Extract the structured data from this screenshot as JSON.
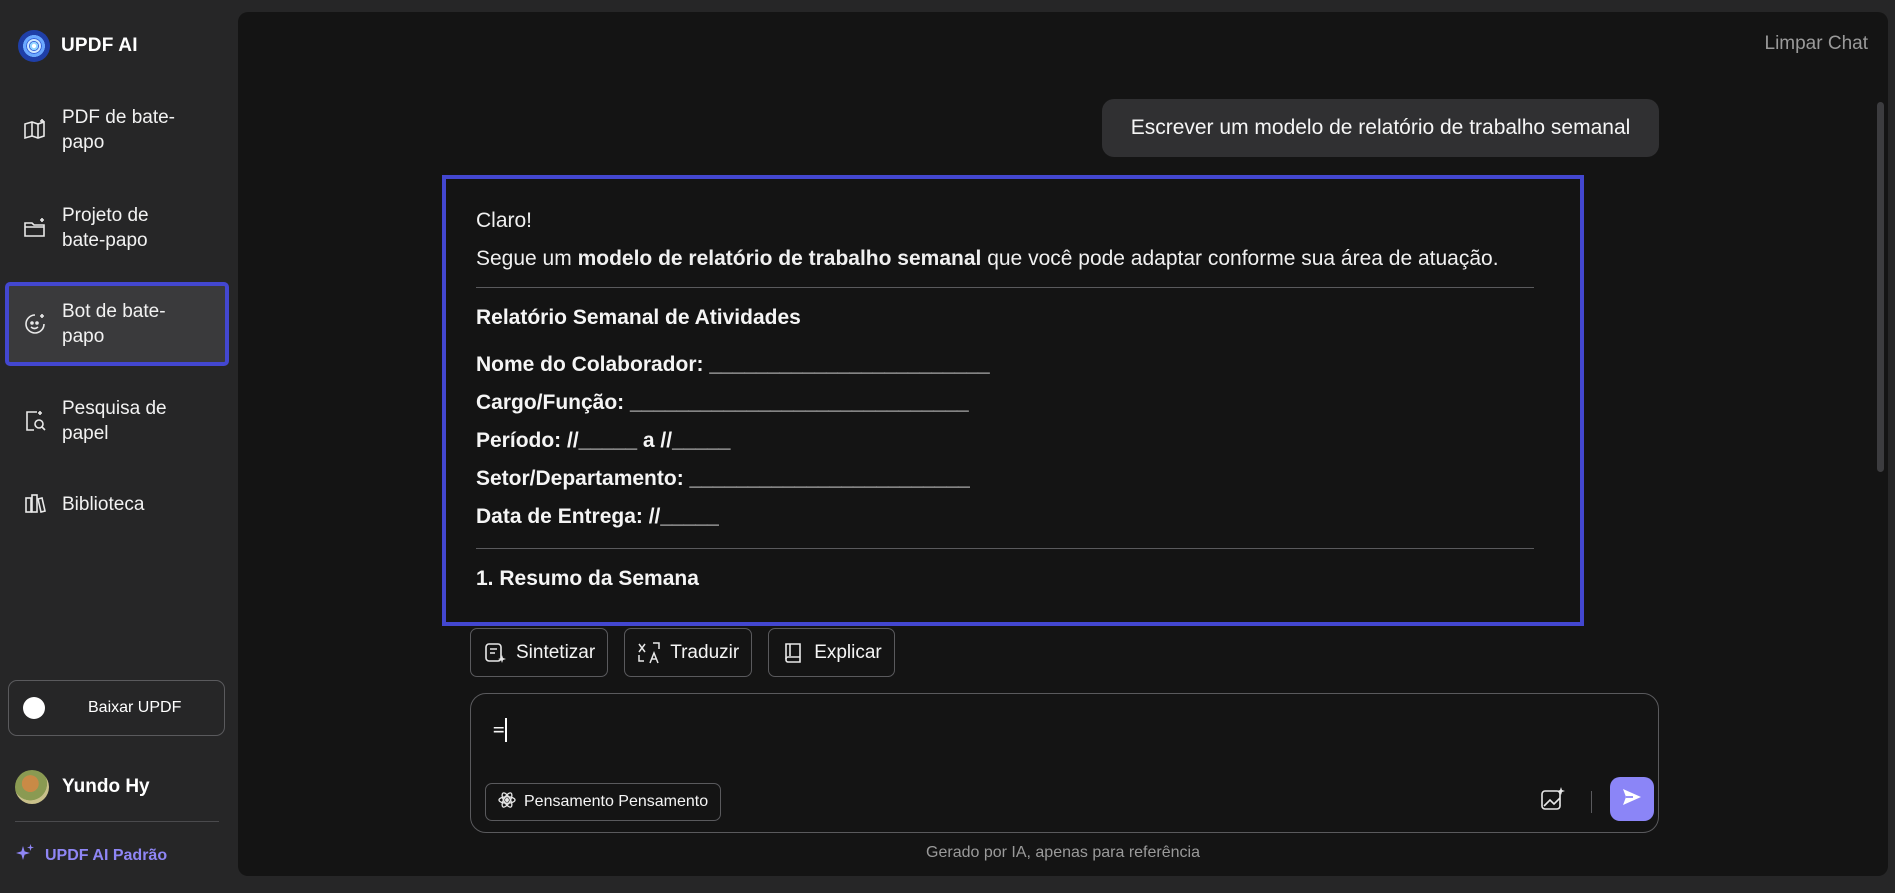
{
  "app": {
    "name": "UPDF AI"
  },
  "sidebar": {
    "items": [
      {
        "label": "PDF de bate-papo",
        "icon": "book-chat-icon"
      },
      {
        "label": "Projeto de bate-papo",
        "icon": "folder-chat-icon"
      },
      {
        "label": "Bot de bate-papo",
        "icon": "bot-icon",
        "active": true
      },
      {
        "label": "Pesquisa de papel",
        "icon": "paper-search-icon"
      },
      {
        "label": "Biblioteca",
        "icon": "library-icon"
      }
    ],
    "download_label": "Baixar UPDF",
    "user_name": "Yundo Hy",
    "plan_label": "UPDF AI Padrão"
  },
  "header": {
    "clear_chat": "Limpar Chat"
  },
  "chat": {
    "user_message": "Escrever um modelo de relatório de trabalho semanal",
    "answer": {
      "greeting": "Claro!",
      "intro_prefix": "Segue um ",
      "intro_bold": "modelo de relatório de trabalho semanal",
      "intro_suffix": " que você pode adaptar conforme sua área de atuação.",
      "title": "Relatório Semanal de Atividades",
      "fields": [
        "Nome do Colaborador: ________________________",
        "Cargo/Função: _____________________________",
        "Período: //_____ a //_____",
        "Setor/Departamento: ________________________",
        "Data de Entrega: //_____"
      ],
      "section_1": "1. Resumo da Semana"
    }
  },
  "actions": {
    "summarize": "Sintetizar",
    "translate": "Traduzir",
    "explain": "Explicar"
  },
  "input": {
    "value": "=",
    "thinking_label": "Pensamento Pensamento"
  },
  "footer": {
    "note": "Gerado por IA, apenas para referência"
  },
  "colors": {
    "accent": "#8b85f7",
    "highlight_border": "#4347d0",
    "panel_bg": "#141414",
    "sidebar_bg": "#262627"
  }
}
